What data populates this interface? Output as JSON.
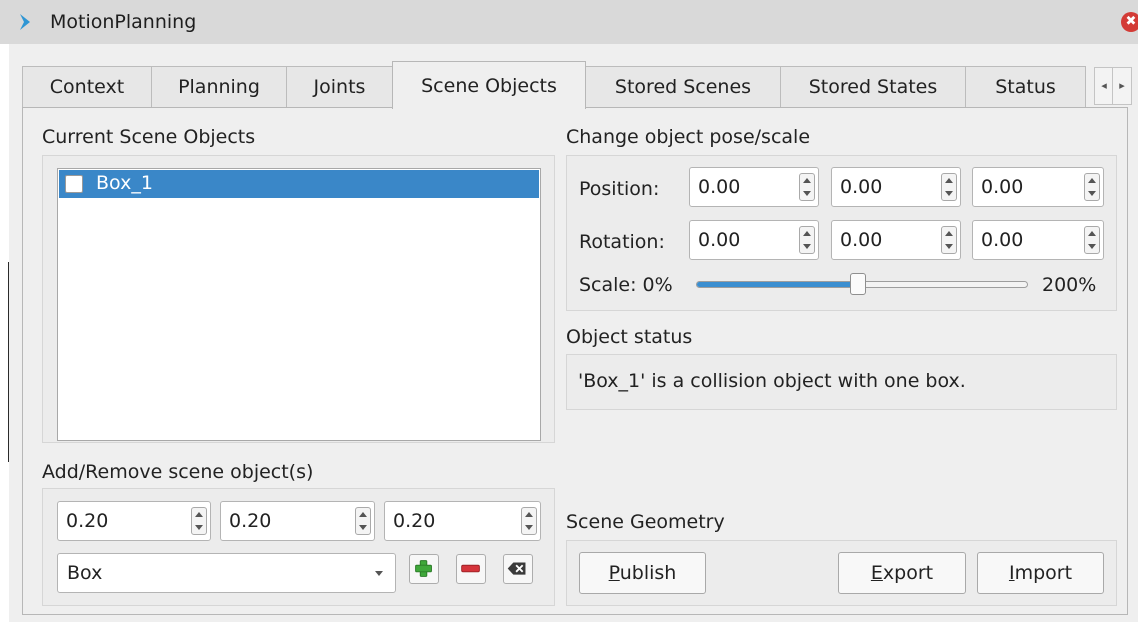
{
  "window": {
    "title": "MotionPlanning",
    "close_glyph": "✖"
  },
  "tabs": [
    {
      "label": "Context"
    },
    {
      "label": "Planning"
    },
    {
      "label": "Joints"
    },
    {
      "label": "Scene Objects",
      "active": true
    },
    {
      "label": "Stored Scenes"
    },
    {
      "label": "Stored States"
    },
    {
      "label": "Status"
    }
  ],
  "scene_objects": {
    "heading": "Current Scene Objects",
    "items": [
      {
        "label": "Box_1",
        "checked": false,
        "selected": true
      }
    ]
  },
  "pose": {
    "heading": "Change object pose/scale",
    "position_label": "Position:",
    "position": [
      "0.00",
      "0.00",
      "0.00"
    ],
    "rotation_label": "Rotation:",
    "rotation": [
      "0.00",
      "0.00",
      "0.00"
    ],
    "scale_label": "Scale: 0%",
    "scale_max": "200%",
    "scale_fraction": 0.5
  },
  "object_status": {
    "heading": "Object status",
    "text": "'Box_1' is a collision object with one box."
  },
  "add_remove": {
    "heading": "Add/Remove scene object(s)",
    "dims": [
      "0.20",
      "0.20",
      "0.20"
    ],
    "shape": "Box"
  },
  "scene_geometry": {
    "heading": "Scene Geometry",
    "publish": {
      "mnemonic": "P",
      "rest": "ublish"
    },
    "export": {
      "mnemonic": "E",
      "rest": "xport"
    },
    "import": {
      "mnemonic": "I",
      "rest": "mport"
    }
  },
  "colors": {
    "selection": "#3a87c8",
    "title_icon": "#2f96d4",
    "add_green": "#3fa83a",
    "remove_red": "#d5343b",
    "close_red": "#d33b36"
  }
}
